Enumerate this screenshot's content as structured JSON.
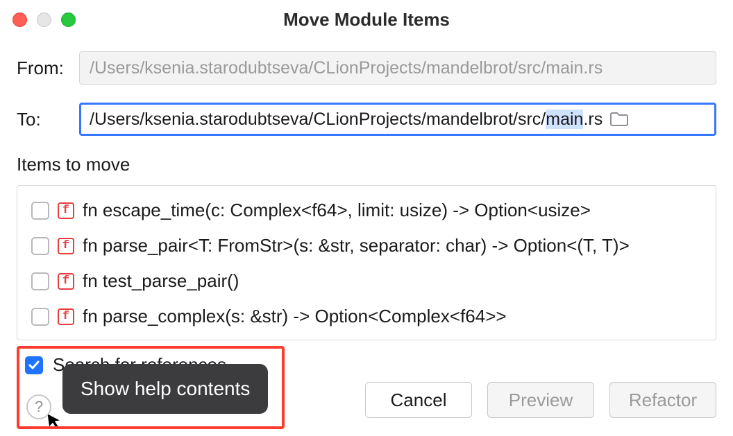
{
  "window": {
    "title": "Move Module Items"
  },
  "form": {
    "from_label": "From:",
    "from_value": "/Users/ksenia.starodubtseva/CLionProjects/mandelbrot/src/main.rs",
    "to_label": "To:",
    "to_prefix": "/Users/ksenia.starodubtseva/CLionProjects/mandelbrot/src/",
    "to_selected": "main",
    "to_suffix": ".rs"
  },
  "items": {
    "section_label": "Items to move",
    "list": [
      {
        "icon": "f",
        "label": "fn escape_time(c: Complex<f64>, limit: usize) -> Option<usize>",
        "checked": false
      },
      {
        "icon": "f",
        "label": "fn parse_pair<T: FromStr>(s: &str, separator: char) -> Option<(T, T)>",
        "checked": false
      },
      {
        "icon": "f",
        "label": "fn test_parse_pair()",
        "checked": false
      },
      {
        "icon": "f",
        "label": "fn parse_complex(s: &str) -> Option<Complex<f64>>",
        "checked": false
      }
    ]
  },
  "search_references": {
    "label": "Search for references",
    "checked": true
  },
  "tooltip": {
    "text": "Show help contents"
  },
  "buttons": {
    "cancel": "Cancel",
    "preview": "Preview",
    "refactor": "Refactor"
  },
  "help_glyph": "?"
}
